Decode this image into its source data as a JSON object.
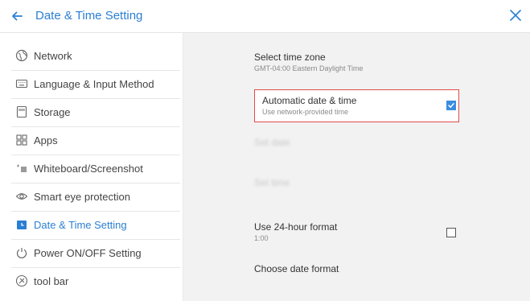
{
  "header": {
    "title": "Date & Time Setting",
    "back_icon": "arrow-left-icon",
    "close_icon": "close-icon",
    "accent_color": "#2b7fd3"
  },
  "sidebar": {
    "items": [
      {
        "label": "Network",
        "icon": "globe-icon",
        "active": false
      },
      {
        "label": "Language & Input Method",
        "icon": "keyboard-icon",
        "active": false
      },
      {
        "label": "Storage",
        "icon": "storage-icon",
        "active": false
      },
      {
        "label": "Apps",
        "icon": "apps-grid-icon",
        "active": false
      },
      {
        "label": "Whiteboard/Screenshot",
        "icon": "whiteboard-icon",
        "active": false
      },
      {
        "label": "Smart eye protection",
        "icon": "eye-icon",
        "active": false
      },
      {
        "label": "Date & Time Setting",
        "icon": "clock-square-icon",
        "active": true
      },
      {
        "label": "Power ON/OFF Setting",
        "icon": "power-icon",
        "active": false
      },
      {
        "label": "tool bar",
        "icon": "toolbar-icon",
        "active": false
      }
    ]
  },
  "settings": {
    "timezone": {
      "title": "Select time zone",
      "subtitle": "GMT-04:00 Eastern Daylight Time"
    },
    "auto_datetime": {
      "title": "Automatic date & time",
      "subtitle": "Use network-provided time",
      "checked": true
    },
    "set_date": {
      "title": "Set date",
      "subtitle": ""
    },
    "set_time": {
      "title": "Set time",
      "subtitle": ""
    },
    "format24": {
      "title": "Use 24-hour format",
      "subtitle": "1:00",
      "checked": false
    },
    "date_format": {
      "title": "Choose date format"
    }
  }
}
